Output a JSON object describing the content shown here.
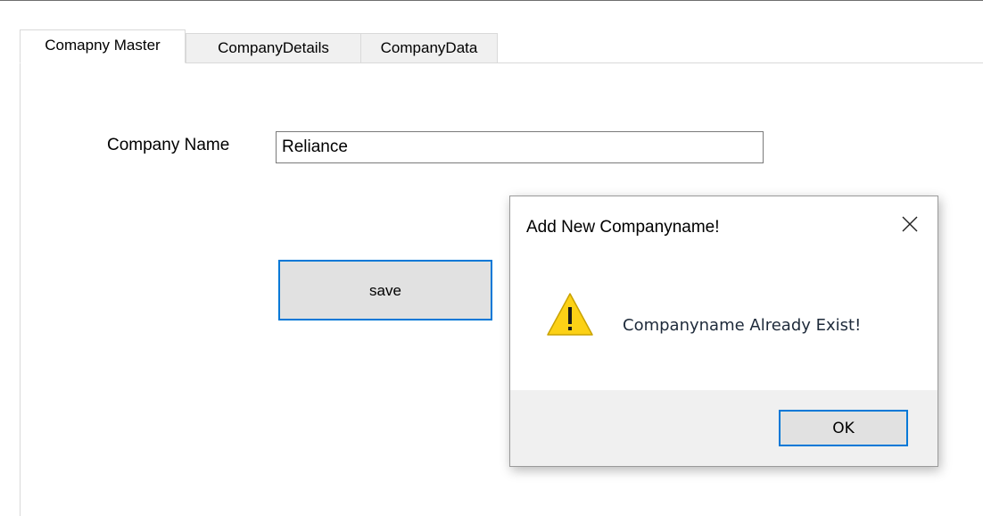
{
  "tabs": [
    {
      "label": "Comapny Master",
      "active": true
    },
    {
      "label": "CompanyDetails",
      "active": false
    },
    {
      "label": "CompanyData",
      "active": false
    }
  ],
  "form": {
    "company_name_label": "Company Name",
    "company_name_value": "Reliance",
    "save_label": "save"
  },
  "dialog": {
    "title": "Add New Companyname!",
    "message": "Companyname Already Exist!",
    "ok_label": "OK",
    "close_icon": "close-icon",
    "warning_icon": "warning-icon"
  },
  "colors": {
    "focus_border": "#0078d7",
    "warning_yellow": "#fcd116",
    "button_face": "#e1e1e1",
    "footer_bg": "#f0f0f0"
  }
}
